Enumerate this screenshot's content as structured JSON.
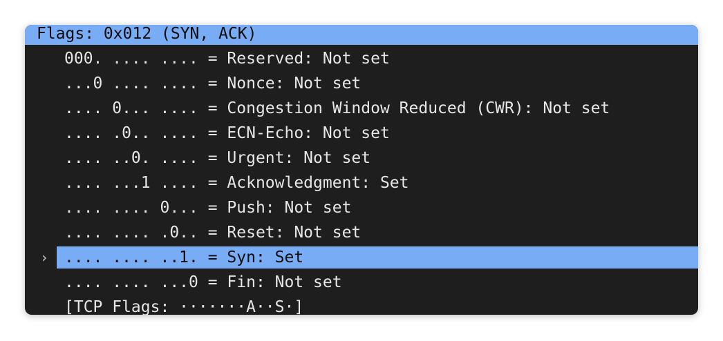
{
  "header": {
    "label": "Flags: 0x012 (SYN, ACK)"
  },
  "rows": [
    {
      "label": "000. .... .... = Reserved: Not set"
    },
    {
      "label": "...0 .... .... = Nonce: Not set"
    },
    {
      "label": ".... 0... .... = Congestion Window Reduced (CWR): Not set"
    },
    {
      "label": ".... .0.. .... = ECN-Echo: Not set"
    },
    {
      "label": ".... ..0. .... = Urgent: Not set"
    },
    {
      "label": ".... ...1 .... = Acknowledgment: Set"
    },
    {
      "label": ".... .... 0... = Push: Not set"
    },
    {
      "label": ".... .... .0.. = Reset: Not set"
    },
    {
      "label": ".... .... ..1. = Syn: Set",
      "expand_icon": "chevron-right-icon",
      "expand_glyph": "›"
    },
    {
      "label": ".... .... ...0 = Fin: Not set"
    },
    {
      "label": "[TCP Flags: ·······A··S·]"
    }
  ],
  "colors": {
    "selection": "#78acf5",
    "background": "#1e1e1e",
    "text": "#e6e6e6"
  }
}
